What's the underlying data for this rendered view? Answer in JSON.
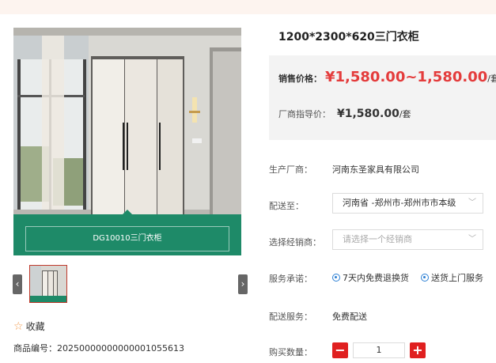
{
  "product": {
    "title": "1200*2300*620三门衣柜",
    "image_caption": "DG10010三门衣柜",
    "favorite_label": "收藏",
    "sku_label": "商品编号：",
    "sku_value": "20250000000000001055613"
  },
  "price": {
    "sale_label": "销售价格：",
    "sale_value": "¥1,580.00~1,580.00",
    "sale_unit": "/套",
    "guide_label": "厂商指导价：",
    "guide_value": "¥1,580.00",
    "guide_unit": "/套"
  },
  "details": {
    "manufacturer_label": "生产厂商：",
    "manufacturer_value": "河南东圣家具有限公司",
    "delivery_to_label": "配送至：",
    "delivery_to_value": "河南省 -郑州市-郑州市市本级",
    "dealer_label": "选择经销商：",
    "dealer_placeholder": "请选择一个经销商",
    "service_label": "服务承诺：",
    "service_items": [
      "7天内免费退换货",
      "送货上门服务"
    ],
    "delivery_service_label": "配送服务：",
    "delivery_service_value": "免费配送",
    "quantity_label": "购买数量：",
    "quantity_value": "1"
  },
  "controls": {
    "minus": "−",
    "plus": "+",
    "prev": "‹",
    "next": "›",
    "chevron": "﹀",
    "star": "☆"
  },
  "colors": {
    "price_red": "#e43c3c",
    "button_red": "#e02020",
    "banner_green": "#1e8a68",
    "icon_blue": "#2a7fd4"
  }
}
